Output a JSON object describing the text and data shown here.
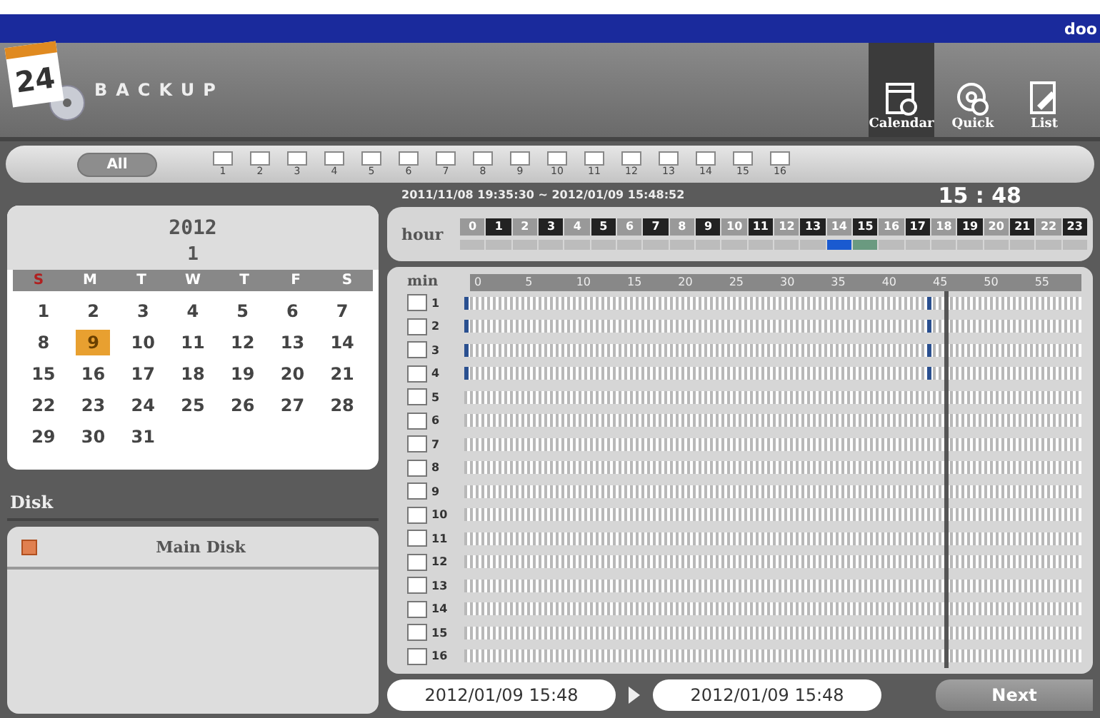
{
  "brand": "doo",
  "header": {
    "calendar_icon_text": "24",
    "title": "BACKUP",
    "tabs": [
      {
        "label": "Calendar",
        "kind": "calendar",
        "selected": true
      },
      {
        "label": "Quick",
        "kind": "quick",
        "selected": false
      },
      {
        "label": "List",
        "kind": "list",
        "selected": false
      }
    ]
  },
  "channel_bar": {
    "all_button": "All",
    "channels": [
      {
        "label": "1",
        "checked": false
      },
      {
        "label": "2",
        "checked": false
      },
      {
        "label": "3",
        "checked": false
      },
      {
        "label": "4",
        "checked": false
      },
      {
        "label": "5",
        "checked": false
      },
      {
        "label": "6",
        "checked": false
      },
      {
        "label": "7",
        "checked": false
      },
      {
        "label": "8",
        "checked": false
      },
      {
        "label": "9",
        "checked": false
      },
      {
        "label": "10",
        "checked": false
      },
      {
        "label": "11",
        "checked": false
      },
      {
        "label": "12",
        "checked": false
      },
      {
        "label": "13",
        "checked": false
      },
      {
        "label": "14",
        "checked": false
      },
      {
        "label": "15",
        "checked": false
      },
      {
        "label": "16",
        "checked": false
      }
    ]
  },
  "range": "2011/11/08 19:35:30 ~ 2012/01/09 15:48:52",
  "clock": "15 : 48",
  "calendar": {
    "year": "2012",
    "month": "1",
    "weekdays": [
      {
        "label": "S",
        "kind": "sunday"
      },
      {
        "label": "M",
        "kind": "weekday"
      },
      {
        "label": "T",
        "kind": "weekday"
      },
      {
        "label": "W",
        "kind": "weekday"
      },
      {
        "label": "T",
        "kind": "weekday"
      },
      {
        "label": "F",
        "kind": "weekday"
      },
      {
        "label": "S",
        "kind": "weekday"
      }
    ],
    "days": [
      {
        "label": "1",
        "selected": false
      },
      {
        "label": "2",
        "selected": false
      },
      {
        "label": "3",
        "selected": false
      },
      {
        "label": "4",
        "selected": false
      },
      {
        "label": "5",
        "selected": false
      },
      {
        "label": "6",
        "selected": false
      },
      {
        "label": "7",
        "selected": false
      },
      {
        "label": "8",
        "selected": false
      },
      {
        "label": "9",
        "selected": true
      },
      {
        "label": "10",
        "selected": false
      },
      {
        "label": "11",
        "selected": false
      },
      {
        "label": "12",
        "selected": false
      },
      {
        "label": "13",
        "selected": false
      },
      {
        "label": "14",
        "selected": false
      },
      {
        "label": "15",
        "selected": false
      },
      {
        "label": "16",
        "selected": false
      },
      {
        "label": "17",
        "selected": false
      },
      {
        "label": "18",
        "selected": false
      },
      {
        "label": "19",
        "selected": false
      },
      {
        "label": "20",
        "selected": false
      },
      {
        "label": "21",
        "selected": false
      },
      {
        "label": "22",
        "selected": false
      },
      {
        "label": "23",
        "selected": false
      },
      {
        "label": "24",
        "selected": false
      },
      {
        "label": "25",
        "selected": false
      },
      {
        "label": "26",
        "selected": false
      },
      {
        "label": "27",
        "selected": false
      },
      {
        "label": "28",
        "selected": false
      },
      {
        "label": "29",
        "selected": false
      },
      {
        "label": "30",
        "selected": false
      },
      {
        "label": "31",
        "selected": false
      }
    ]
  },
  "disk": {
    "title": "Disk",
    "items": [
      {
        "label": "Main Disk",
        "checked": true
      }
    ]
  },
  "hours": {
    "label": "hour",
    "items": [
      {
        "label": "0",
        "kind": "empty"
      },
      {
        "label": "1",
        "kind": "empty"
      },
      {
        "label": "2",
        "kind": "empty"
      },
      {
        "label": "3",
        "kind": "empty"
      },
      {
        "label": "4",
        "kind": "empty"
      },
      {
        "label": "5",
        "kind": "empty"
      },
      {
        "label": "6",
        "kind": "empty"
      },
      {
        "label": "7",
        "kind": "empty"
      },
      {
        "label": "8",
        "kind": "empty"
      },
      {
        "label": "9",
        "kind": "empty"
      },
      {
        "label": "10",
        "kind": "empty"
      },
      {
        "label": "11",
        "kind": "empty"
      },
      {
        "label": "12",
        "kind": "empty"
      },
      {
        "label": "13",
        "kind": "empty"
      },
      {
        "label": "14",
        "kind": "selected"
      },
      {
        "label": "15",
        "kind": "recorded"
      },
      {
        "label": "16",
        "kind": "empty"
      },
      {
        "label": "17",
        "kind": "empty"
      },
      {
        "label": "18",
        "kind": "empty"
      },
      {
        "label": "19",
        "kind": "empty"
      },
      {
        "label": "20",
        "kind": "empty"
      },
      {
        "label": "21",
        "kind": "empty"
      },
      {
        "label": "22",
        "kind": "empty"
      },
      {
        "label": "23",
        "kind": "empty"
      }
    ]
  },
  "minutes": {
    "label": "min",
    "ticks": [
      "0",
      "5",
      "10",
      "15",
      "20",
      "25",
      "30",
      "35",
      "40",
      "45",
      "50",
      "55"
    ],
    "cursor": {
      "level": 0.775
    },
    "channels": [
      {
        "label": "1",
        "checked": false,
        "recordings": [
          {
            "level": 0
          },
          {
            "level": 0.75
          }
        ]
      },
      {
        "label": "2",
        "checked": false,
        "recordings": [
          {
            "level": 0
          },
          {
            "level": 0.75
          }
        ]
      },
      {
        "label": "3",
        "checked": false,
        "recordings": [
          {
            "level": 0
          },
          {
            "level": 0.75
          }
        ]
      },
      {
        "label": "4",
        "checked": false,
        "recordings": [
          {
            "level": 0
          },
          {
            "level": 0.75
          }
        ]
      },
      {
        "label": "5",
        "checked": false
      },
      {
        "label": "6",
        "checked": false
      },
      {
        "label": "7",
        "checked": false
      },
      {
        "label": "8",
        "checked": false
      },
      {
        "label": "9",
        "checked": false
      },
      {
        "label": "10",
        "checked": false
      },
      {
        "label": "11",
        "checked": false
      },
      {
        "label": "12",
        "checked": false
      },
      {
        "label": "13",
        "checked": false
      },
      {
        "label": "14",
        "checked": false
      },
      {
        "label": "15",
        "checked": false
      },
      {
        "label": "16",
        "checked": false
      }
    ]
  },
  "footer": {
    "start": "2012/01/09 15:48",
    "end": "2012/01/09 15:48",
    "next_button": "Next"
  }
}
